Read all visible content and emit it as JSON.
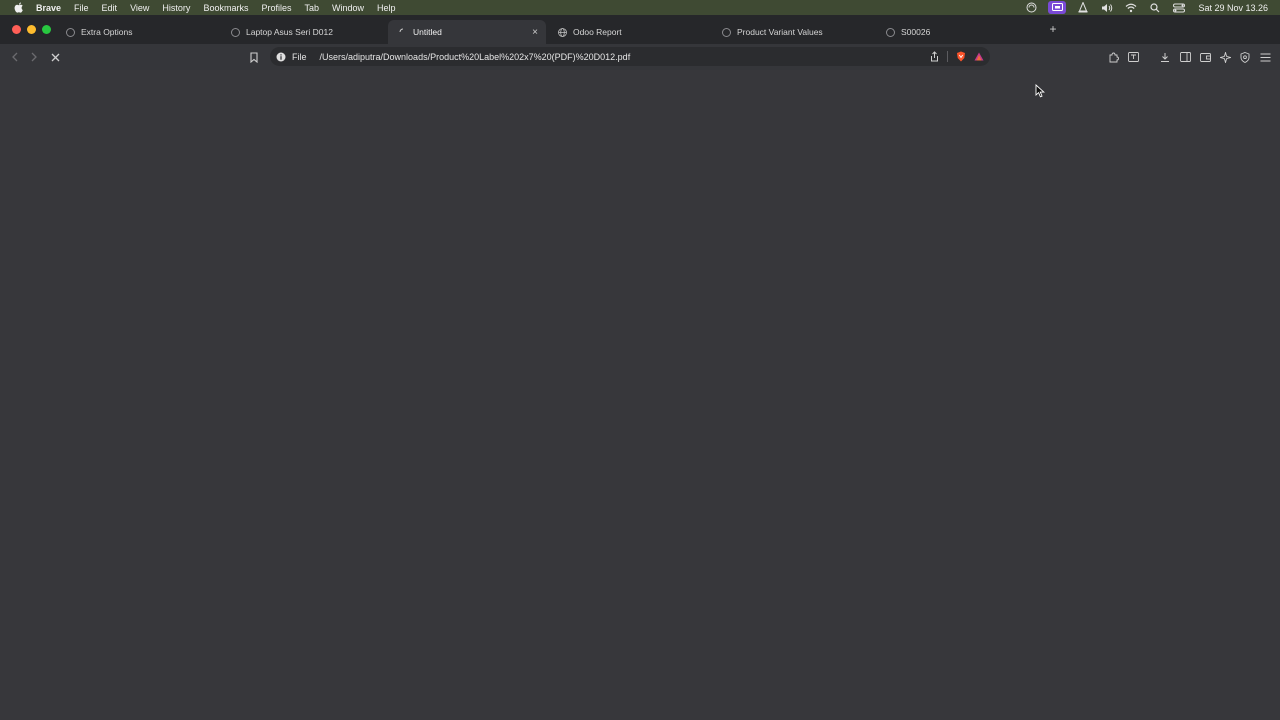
{
  "menubar": {
    "app_name": "Brave",
    "items": [
      "File",
      "Edit",
      "View",
      "History",
      "Bookmarks",
      "Profiles",
      "Tab",
      "Window",
      "Help"
    ],
    "clock": "Sat 29 Nov  13.26"
  },
  "tabs": [
    {
      "title": "Extra Options"
    },
    {
      "title": "Laptop Asus Seri D012"
    },
    {
      "title": "Untitled"
    },
    {
      "title": "Odoo Report"
    },
    {
      "title": "Product Variant Values"
    },
    {
      "title": "S00026"
    }
  ],
  "toolbar": {
    "scheme": "File",
    "url": "/Users/adiputra/Downloads/Product%20Label%202x7%20(PDF)%20D012.pdf"
  },
  "colors": {
    "menubar_bg": "#3f4a33",
    "tabstrip_bg": "#26272a",
    "toolbar_bg": "#35363a",
    "content_bg": "#37373b",
    "brave_orange": "#fb542b"
  }
}
